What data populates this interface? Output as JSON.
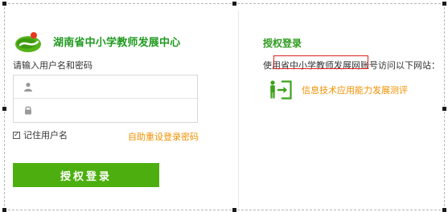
{
  "site": {
    "title": "湖南省中小学教师发展中心"
  },
  "login": {
    "prompt": "请输入用户名和密码",
    "username_value": "",
    "password_value": "",
    "remember_label": "记住用户名",
    "remember_checked": true,
    "reset_link": "自助重设登录密码",
    "submit_label": "授权登录"
  },
  "authorize": {
    "title": "授权登录",
    "description": "使用省中小学教师发展网账号访问以下网站：",
    "app_name": "信息技术应用能力发展测评"
  },
  "colors": {
    "brand_green": "#4caf0f",
    "title_green": "#1f9a1f",
    "link_orange": "#f29100",
    "highlight_red": "#e02020"
  },
  "icons": {
    "logo": "center-logo",
    "username": "user-icon",
    "password": "lock-icon",
    "app": "exit-door-icon"
  }
}
